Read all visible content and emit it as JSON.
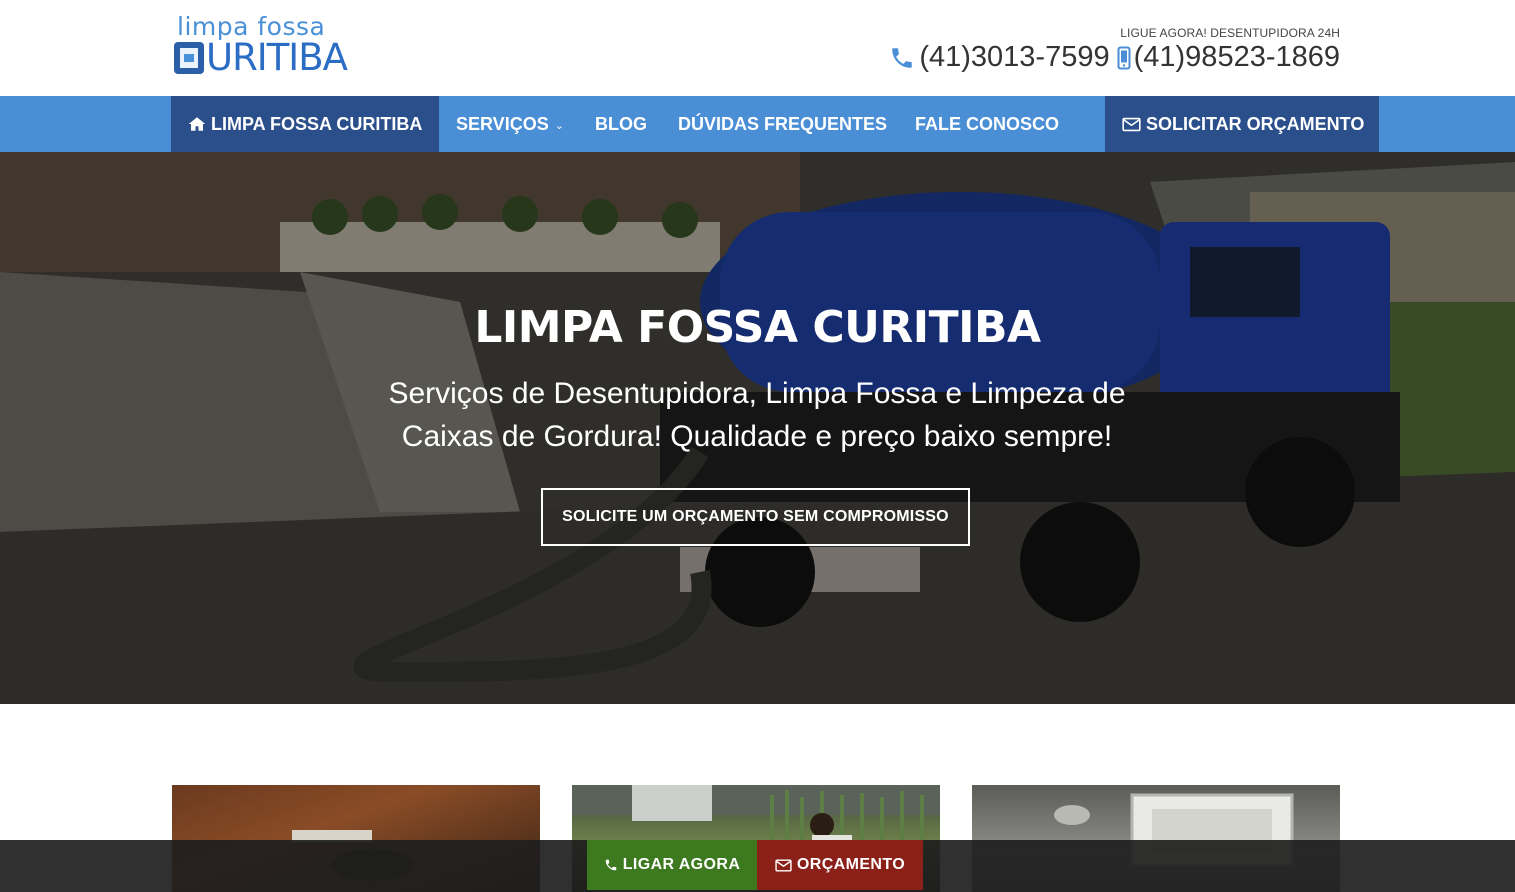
{
  "logo": {
    "line1": "limpa fossa",
    "line2": "URITIBA"
  },
  "header": {
    "tagline": "LIGUE AGORA! DESENTUPIDORA 24H",
    "phone1": "(41)3013-7599",
    "phone2": "(41)98523-1869"
  },
  "nav": {
    "home": "LIMPA FOSSA CURITIBA",
    "servicos": "SERVIÇOS",
    "blog": "BLOG",
    "duvidas": "DÚVIDAS FREQUENTES",
    "fale": "FALE CONOSCO",
    "orcamento": "SOLICITAR ORÇAMENTO"
  },
  "hero": {
    "title": "LIMPA FOSSA CURITIBA",
    "subtitle": "Serviços de Desentupidora, Limpa Fossa e Limpeza de Caixas de Gordura! Qualidade e preço baixo sempre!",
    "cta": "SOLICITE UM ORÇAMENTO SEM COMPROMISSO"
  },
  "bottom_bar": {
    "call": "LIGAR AGORA",
    "quote": "ORÇAMENTO"
  },
  "colors": {
    "nav_bg": "#4a8ed6",
    "nav_active": "#2b4f8a",
    "call_btn": "#3d7a1f",
    "quote_btn": "#8a2018"
  },
  "icons": [
    "home-icon",
    "chevron-down-icon",
    "envelope-icon",
    "phone-icon",
    "mobile-icon"
  ]
}
